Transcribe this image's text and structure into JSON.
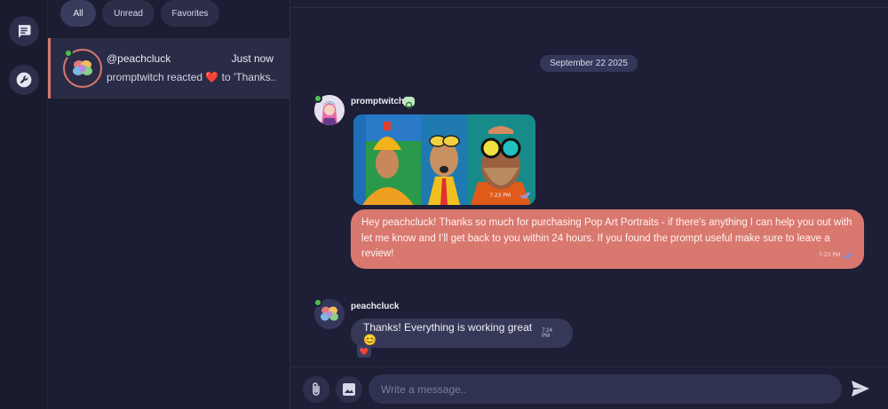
{
  "filters": [
    {
      "label": "All",
      "active": true
    },
    {
      "label": "Unread",
      "active": false
    },
    {
      "label": "Favorites",
      "active": false
    }
  ],
  "rail": {
    "icons": [
      "chat-icon",
      "wrench-icon"
    ]
  },
  "conversation": {
    "name": "@peachcluck",
    "time": "Just now",
    "preview": "promptwitch reacted ❤️ to 'Thanks..."
  },
  "chat": {
    "date_divider": "September 22 2025",
    "messages": [
      {
        "sender": "promptwitch",
        "image_time": "7:23 PM",
        "text": "Hey peachcluck! Thanks so much for purchasing Pop Art Portraits - if there's anything I can help you out with let me know and I'll get back to you within 24 hours. If you found the prompt useful make sure to leave a review!",
        "time": "7:23 PM"
      },
      {
        "sender": "peachcluck",
        "text": "Thanks! Everything is working great 😊",
        "time": "7:24 PM",
        "reaction": "❤️"
      }
    ]
  },
  "composer": {
    "placeholder": "Write a message.."
  },
  "colors": {
    "accent": "#d9786f",
    "background": "#1e1f36",
    "online": "#4cc24c"
  }
}
